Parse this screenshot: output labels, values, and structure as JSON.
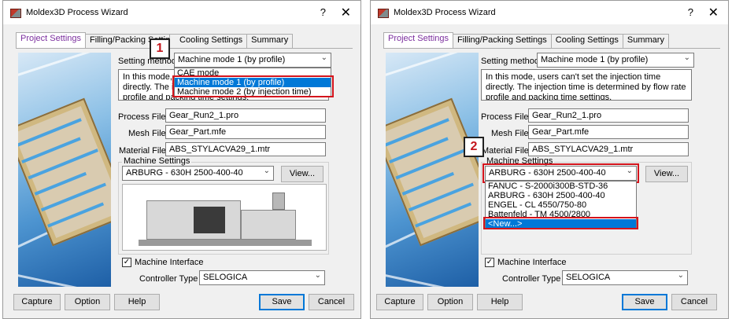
{
  "window": {
    "title": "Moldex3D Process Wizard",
    "help_glyph": "?",
    "close_glyph": "✕"
  },
  "tabs": [
    {
      "label": "Project Settings"
    },
    {
      "label": "Filling/Packing Settings"
    },
    {
      "label": "Cooling Settings"
    },
    {
      "label": "Summary"
    }
  ],
  "form": {
    "setting_method_label": "Setting method :",
    "setting_method_value": "Machine mode 1 (by profile)",
    "description": "In this mode, users can't set the injection time directly. The injection time is determined by flow rate profile and packing time settings.",
    "description_a": "In this mode, users can't set the injection time directly. The injection time is determined by flow rate profile and packing time settings.",
    "process_file_label": "Process File :",
    "process_file_value": "Gear_Run2_1.pro",
    "mesh_file_label": "Mesh File :",
    "mesh_file_value": "Gear_Part.mfe",
    "material_file_label": "Material File :",
    "material_file_value": "ABS_STYLACVA29_1.mtr",
    "machine_settings_title": "Machine Settings",
    "machine_value": "ARBURG - 630H 2500-400-40",
    "view_button": "View...",
    "machine_interface_label": "Machine Interface",
    "machine_interface_checked": true,
    "controller_type_label": "Controller Type :",
    "controller_type_value": "SELOGICA"
  },
  "dropdown_method": {
    "items": [
      "CAE mode",
      "Machine mode 1 (by profile)",
      "Machine mode 2 (by injection time)"
    ],
    "selected": "Machine mode 1 (by profile)"
  },
  "dropdown_machine": {
    "items": [
      "FANUC - S-2000i300B-STD-36",
      "ARBURG - 630H 2500-400-40",
      "ENGEL - CL 4550/750-80",
      "Battenfeld - TM 4500/2800",
      "<New...>"
    ],
    "selected": "<New...>"
  },
  "buttons": {
    "capture": "Capture",
    "option": "Option",
    "help": "Help",
    "save": "Save",
    "cancel": "Cancel"
  },
  "callouts": {
    "step1": "1",
    "step2": "2"
  },
  "colors": {
    "highlight": "#d4141c",
    "selection": "#0078d7",
    "active_tab": "#7b2e9e"
  }
}
